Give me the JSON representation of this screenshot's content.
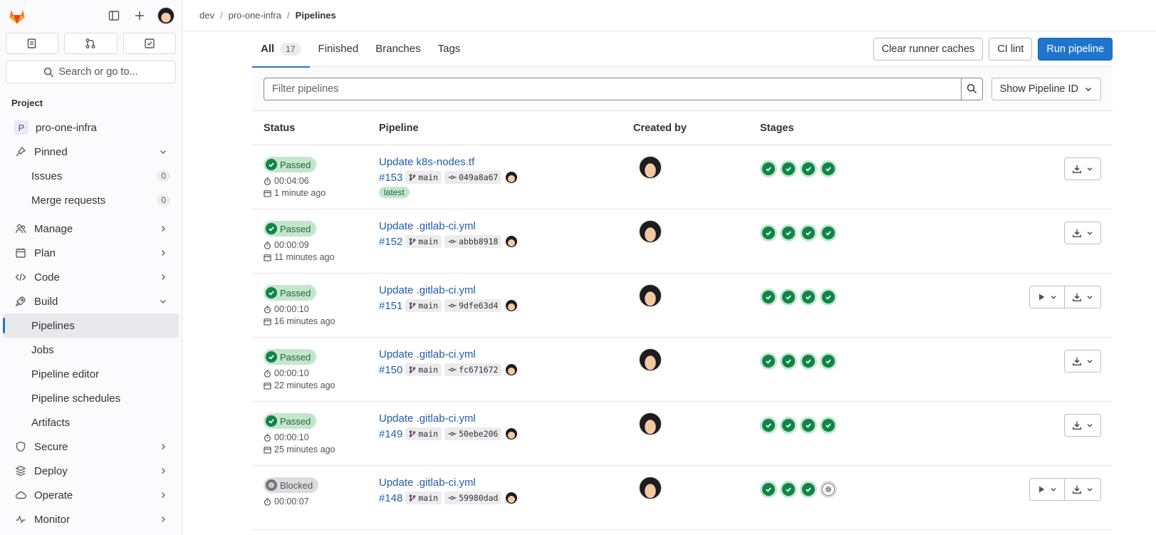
{
  "breadcrumb": [
    "dev",
    "pro-one-infra",
    "Pipelines"
  ],
  "sidebar": {
    "search_label": "Search or go to...",
    "section_title": "Project",
    "project_initial": "P",
    "project_name": "pro-one-infra",
    "pinned_label": "Pinned",
    "issues_label": "Issues",
    "issues_count": "0",
    "mr_label": "Merge requests",
    "mr_count": "0",
    "manage": "Manage",
    "plan": "Plan",
    "code": "Code",
    "build": "Build",
    "build_items": [
      "Pipelines",
      "Jobs",
      "Pipeline editor",
      "Pipeline schedules",
      "Artifacts"
    ],
    "secure": "Secure",
    "deploy": "Deploy",
    "operate": "Operate",
    "monitor": "Monitor"
  },
  "tabs": {
    "all": "All",
    "all_count": "17",
    "finished": "Finished",
    "branches": "Branches",
    "tags": "Tags"
  },
  "actions": {
    "clear_caches": "Clear runner caches",
    "ci_lint": "CI lint",
    "run_pipeline": "Run pipeline"
  },
  "filter": {
    "placeholder": "Filter pipelines",
    "show_id": "Show Pipeline ID"
  },
  "table": {
    "headers": [
      "Status",
      "Pipeline",
      "Created by",
      "Stages"
    ],
    "rows": [
      {
        "status": "Passed",
        "duration": "00:04:06",
        "ago": "1 minute ago",
        "title": "Update k8s-nodes.tf",
        "id": "#153",
        "branch": "main",
        "commit": "049a8a67",
        "tag": "latest"
      },
      {
        "status": "Passed",
        "duration": "00:00:09",
        "ago": "11 minutes ago",
        "title": "Update .gitlab-ci.yml",
        "id": "#152",
        "branch": "main",
        "commit": "abbb8918"
      },
      {
        "status": "Passed",
        "duration": "00:00:10",
        "ago": "16 minutes ago",
        "title": "Update .gitlab-ci.yml",
        "id": "#151",
        "branch": "main",
        "commit": "9dfe63d4"
      },
      {
        "status": "Passed",
        "duration": "00:00:10",
        "ago": "22 minutes ago",
        "title": "Update .gitlab-ci.yml",
        "id": "#150",
        "branch": "main",
        "commit": "fc671672"
      },
      {
        "status": "Passed",
        "duration": "00:00:10",
        "ago": "25 minutes ago",
        "title": "Update .gitlab-ci.yml",
        "id": "#149",
        "branch": "main",
        "commit": "50ebe206"
      },
      {
        "status": "Blocked",
        "duration": "00:00:07",
        "ago": "",
        "title": "Update .gitlab-ci.yml",
        "id": "#148",
        "branch": "main",
        "commit": "59980dad"
      }
    ]
  },
  "colors": {
    "accent": "#1f75cb",
    "success": "#108548",
    "link": "#1f5dad"
  }
}
